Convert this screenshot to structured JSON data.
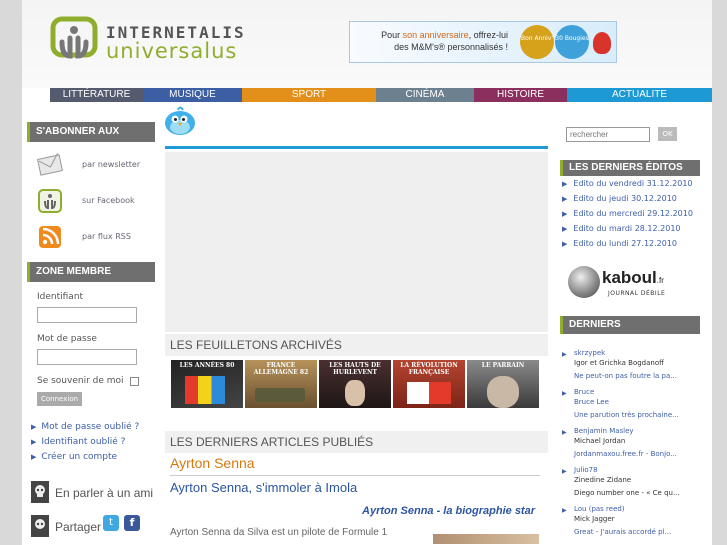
{
  "header": {
    "logo_line1": "INTERNETALIS",
    "logo_line2": "universalus",
    "banner_text_pre": "Pour ",
    "banner_text_highlight": "son anniversaire",
    "banner_text_post": ", offrez-lui",
    "banner_text_line2": "des M&M's® personnalisés !",
    "badge1": "Bon Anniv'",
    "badge2": "30 Bougies"
  },
  "nav": [
    {
      "label": "LITTÉRATURE",
      "color": "#555b6e"
    },
    {
      "label": "MUSIQUE",
      "color": "#3c5fa3"
    },
    {
      "label": "SPORT",
      "color": "#e2901a"
    },
    {
      "label": "CINÉMA",
      "color": "#6d8090"
    },
    {
      "label": "HISTOIRE",
      "color": "#8b2f5e"
    },
    {
      "label": "ACTUALITE",
      "color": "#1d9ad5"
    }
  ],
  "left": {
    "subscribe_title": "S'ABONNER AUX",
    "subscribe_items": [
      "par newsletter",
      "sur Facebook",
      "par flux RSS"
    ],
    "member_title": "ZONE MEMBRE",
    "identifiant_label": "Identifiant",
    "password_label": "Mot de passe",
    "remember_label": "Se souvenir de moi",
    "connexion_label": "Connexion",
    "links": [
      "Mot de passe oublié ?",
      "Identifiant oublié ?",
      "Créer un compte"
    ],
    "share_friend": "En parler à un ami",
    "share_label": "Partager"
  },
  "center": {
    "feuilletons_title": "LES FEUILLETONS ARCHIVÉS",
    "thumbs": [
      {
        "title": "LES ANNÉES 80",
        "bg": "#2a2a2a"
      },
      {
        "title": "FRANCE ALLEMAGNE 82",
        "bg": "#8a6a3a"
      },
      {
        "title": "LES HAUTS DE HURLEVENT",
        "bg": "#3a2a2a"
      },
      {
        "title": "LA RÉVOLUTION FRANÇAISE",
        "bg": "#8a3a2a"
      },
      {
        "title": "LE PARRAIN",
        "bg": "#5a5a5a"
      }
    ],
    "articles_title": "LES DERNIERS ARTICLES PUBLIÉS",
    "article_category": "Ayrton Senna",
    "article_title": "Ayrton Senna, s'immoler à Imola",
    "article_subtitle": "Ayrton Senna - la biographie star",
    "article_excerpt": "Ayrton Senna da Silva est un pilote de Formule 1"
  },
  "right": {
    "search_placeholder": "rechercher",
    "search_button": "OK",
    "editos_title": "LES DERNIERS ÉDITOS",
    "editos": [
      "Edito du vendredi 31.12.2010",
      "Edito du jeudi 30.12.2010",
      "Edito du mercredi 29.12.2010",
      "Edito du mardi 28.12.2010",
      "Edito du lundi 27.12.2010"
    ],
    "kaboul_name": "kaboul",
    "kaboul_tld": ".fr",
    "kaboul_sub": "JOURNAL DÉBILE",
    "derniers_title": "DERNIERS",
    "derniers": [
      {
        "author": "skrzypek",
        "text": "Igor et Grichka Bogdanoff"
      },
      {
        "author": "",
        "text": "Ne peut-on pas foutre la pa..."
      },
      {
        "author": "Bruce",
        "text": "Bruce Lee"
      },
      {
        "author": "",
        "text": "Une parution très prochaine..."
      },
      {
        "author": "Benjamin Masley",
        "text": "Michael Jordan"
      },
      {
        "author": "",
        "text": "Jordanmaxou.free.fr - Bonjo..."
      },
      {
        "author": "Julio78",
        "text": "Zinedine Zidane"
      },
      {
        "author": "",
        "text": "Diego number one - « Ce qu..."
      },
      {
        "author": "Lou (pas reed)",
        "text": "Mick Jagger"
      },
      {
        "author": "",
        "text": "Great - J'aurais accordé pl..."
      }
    ]
  }
}
